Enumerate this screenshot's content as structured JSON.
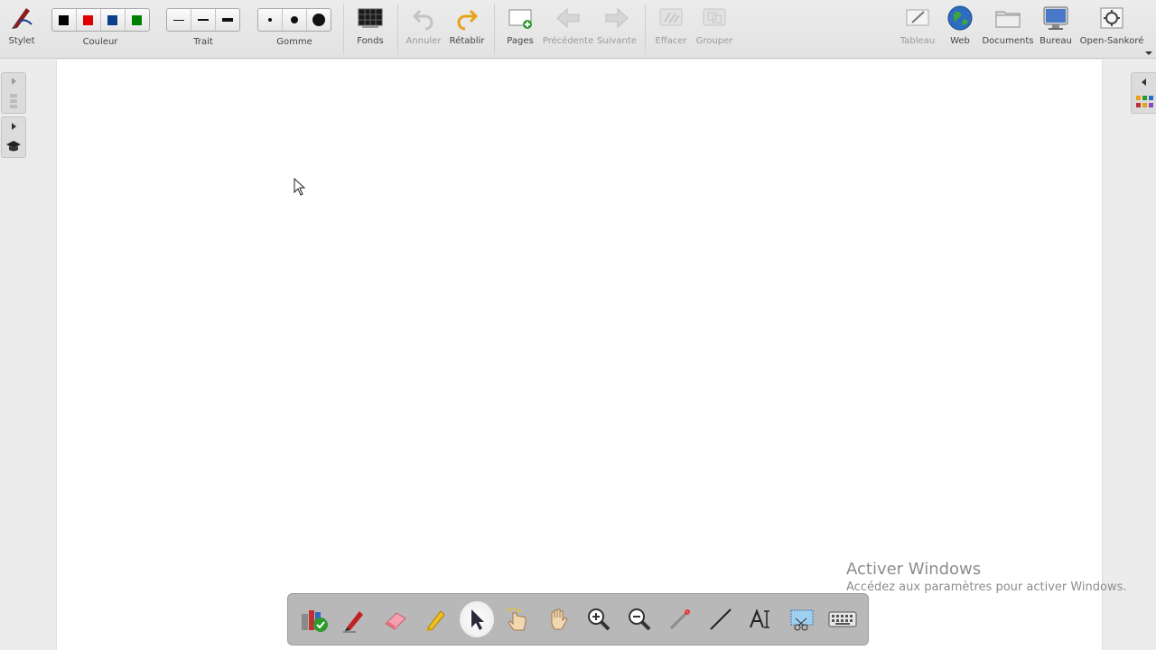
{
  "toolbar": {
    "stylet": "Stylet",
    "couleur": "Couleur",
    "trait": "Trait",
    "gomme": "Gomme",
    "fonds": "Fonds",
    "annuler": "Annuler",
    "retablir": "Rétablir",
    "pages": "Pages",
    "precedente": "Précédente",
    "suivante": "Suivante",
    "effacer": "Effacer",
    "grouper": "Grouper",
    "tableau": "Tableau",
    "web": "Web",
    "documents": "Documents",
    "bureau": "Bureau",
    "open_sankore": "Open-Sankoré"
  },
  "colors": {
    "swatches": [
      "#000000",
      "#e00000",
      "#0a3f8c",
      "#008000"
    ],
    "board": "#ffffff",
    "chrome": "#ececec"
  },
  "palette_tools": [
    "library-icon",
    "pen-icon",
    "eraser-icon",
    "highlighter-icon",
    "selector-icon",
    "interact-icon",
    "hand-icon",
    "zoom-in-icon",
    "zoom-out-icon",
    "laser-pointer-icon",
    "line-icon",
    "text-icon",
    "capture-icon",
    "keyboard-icon"
  ],
  "watermark": {
    "line1": "Activer Windows",
    "line2": "Accédez aux paramètres pour activer Windows."
  }
}
